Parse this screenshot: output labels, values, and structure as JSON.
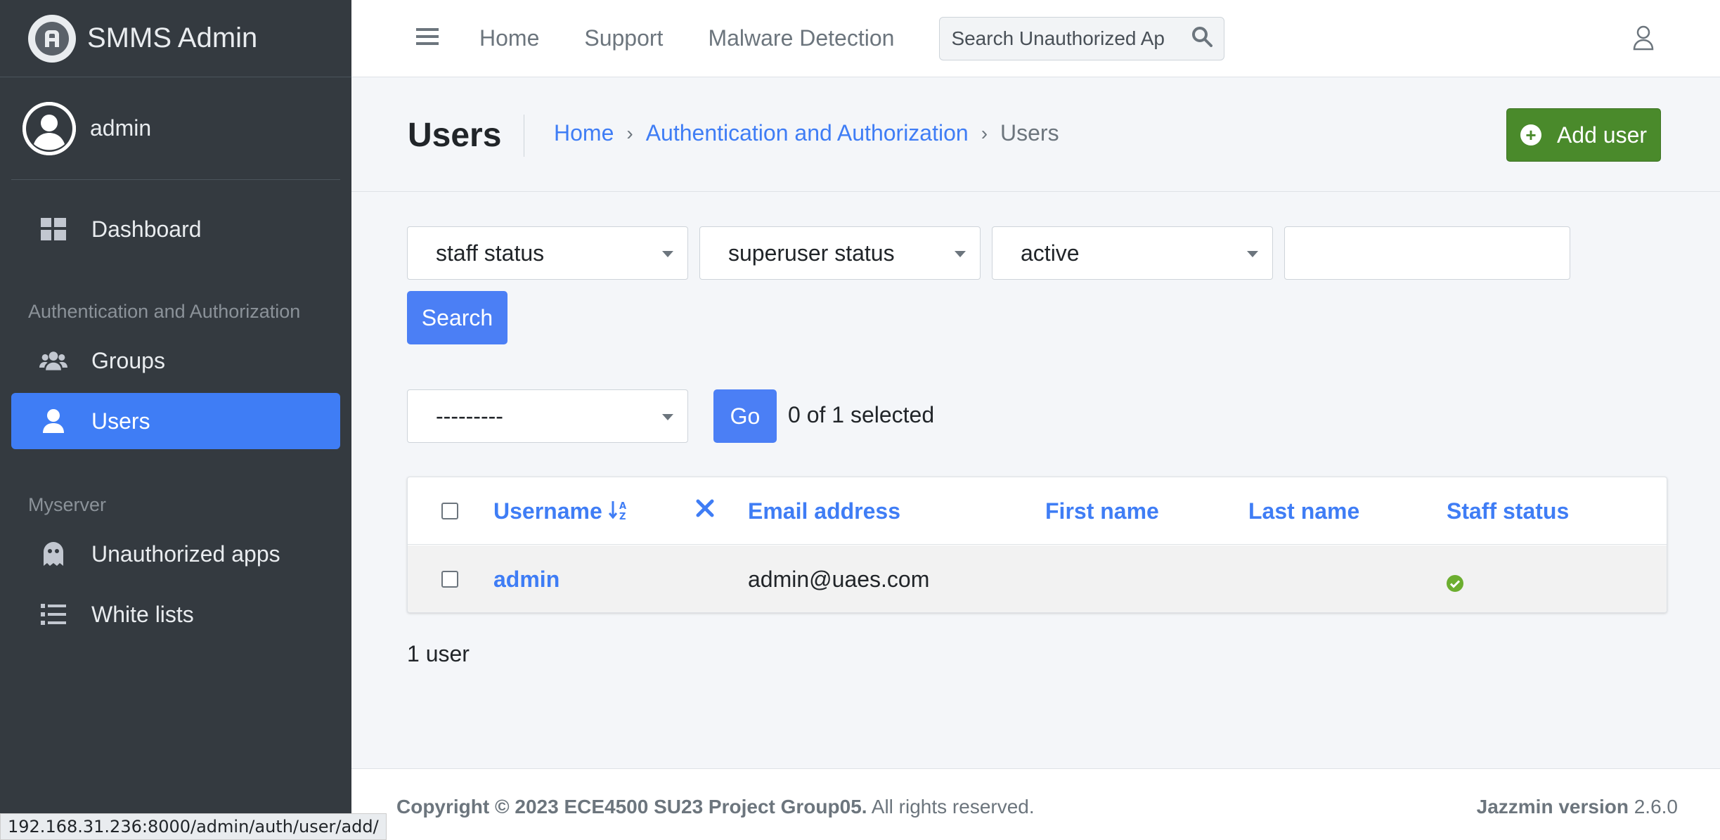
{
  "brand": {
    "name": "SMMS Admin"
  },
  "sidebar": {
    "user": "admin",
    "items": [
      {
        "label": "Dashboard"
      },
      {
        "header": "Authentication and Authorization"
      },
      {
        "label": "Groups"
      },
      {
        "label": "Users"
      },
      {
        "header": "Myserver"
      },
      {
        "label": "Unauthorized apps"
      },
      {
        "label": "White lists"
      }
    ]
  },
  "topnav": {
    "links": [
      "Home",
      "Support",
      "Malware Detection"
    ],
    "search_placeholder": "Search Unauthorized Ap"
  },
  "header": {
    "title": "Users",
    "breadcrumb": [
      "Home",
      "Authentication and Authorization",
      "Users"
    ],
    "add_button": "Add user"
  },
  "filters": {
    "staff": "staff status",
    "superuser": "superuser status",
    "active": "active",
    "search_value": "",
    "search_button": "Search"
  },
  "actions": {
    "selected_action": "---------",
    "go_button": "Go",
    "selected_text": "0 of 1 selected"
  },
  "table": {
    "columns": [
      "Username",
      "Email address",
      "First name",
      "Last name",
      "Staff status"
    ],
    "rows": [
      {
        "username": "admin",
        "email": "admin@uaes.com",
        "first_name": "",
        "last_name": "",
        "staff_status": true
      }
    ]
  },
  "result_count": "1 user",
  "footer": {
    "copyright_bold": "Copyright © 2023 ECE4500 SU23 Project Group05.",
    "copyright_rest": " All rights reserved.",
    "version_bold": "Jazzmin version",
    "version_num": " 2.6.0"
  },
  "status_url": "192.168.31.236:8000/admin/auth/user/add/",
  "colors": {
    "primary": "#3f7df5",
    "success": "#4a8a2b",
    "sidebar": "#343a40"
  }
}
